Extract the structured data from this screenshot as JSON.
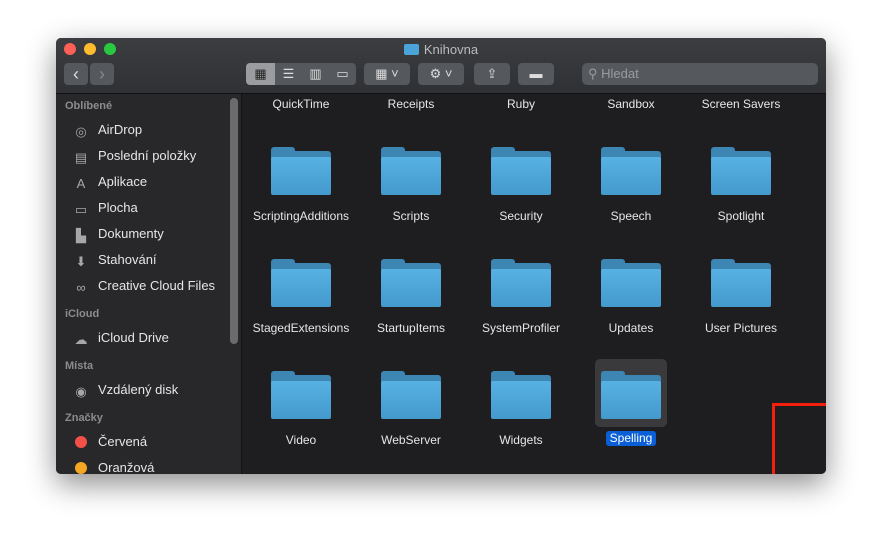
{
  "window": {
    "title": "Knihovna"
  },
  "toolbar": {
    "search_placeholder": "Hledat",
    "back": "‹",
    "forward": "›"
  },
  "sidebar": {
    "sections": [
      {
        "header": "Oblíbené",
        "items": [
          {
            "label": "AirDrop",
            "icon": "airdrop-icon"
          },
          {
            "label": "Poslední položky",
            "icon": "recents-icon"
          },
          {
            "label": "Aplikace",
            "icon": "applications-icon"
          },
          {
            "label": "Plocha",
            "icon": "desktop-icon"
          },
          {
            "label": "Dokumenty",
            "icon": "documents-icon"
          },
          {
            "label": "Stahování",
            "icon": "downloads-icon"
          },
          {
            "label": "Creative Cloud Files",
            "icon": "creative-cloud-icon"
          }
        ]
      },
      {
        "header": "iCloud",
        "items": [
          {
            "label": "iCloud Drive",
            "icon": "cloud-icon"
          }
        ]
      },
      {
        "header": "Místa",
        "items": [
          {
            "label": "Vzdálený disk",
            "icon": "disc-icon"
          }
        ]
      },
      {
        "header": "Značky",
        "items": [
          {
            "label": "Červená",
            "color": "#f4504a"
          },
          {
            "label": "Oranžová",
            "color": "#f5a623"
          }
        ]
      }
    ]
  },
  "content": {
    "top_row": [
      "QuickTime",
      "Receipts",
      "Ruby",
      "Sandbox",
      "Screen Savers"
    ],
    "rows": [
      [
        "ScriptingAdditions",
        "Scripts",
        "Security",
        "Speech",
        "Spotlight"
      ],
      [
        "StagedExtensions",
        "StartupItems",
        "SystemProfiler",
        "Updates",
        "User Pictures"
      ],
      [
        "Video",
        "WebServer",
        "Widgets",
        "Spelling"
      ]
    ],
    "selected": "Spelling"
  },
  "colors": {
    "highlight": "#f21f0a",
    "selection": "#0a5fd6",
    "folder": "#4aa3d9"
  }
}
